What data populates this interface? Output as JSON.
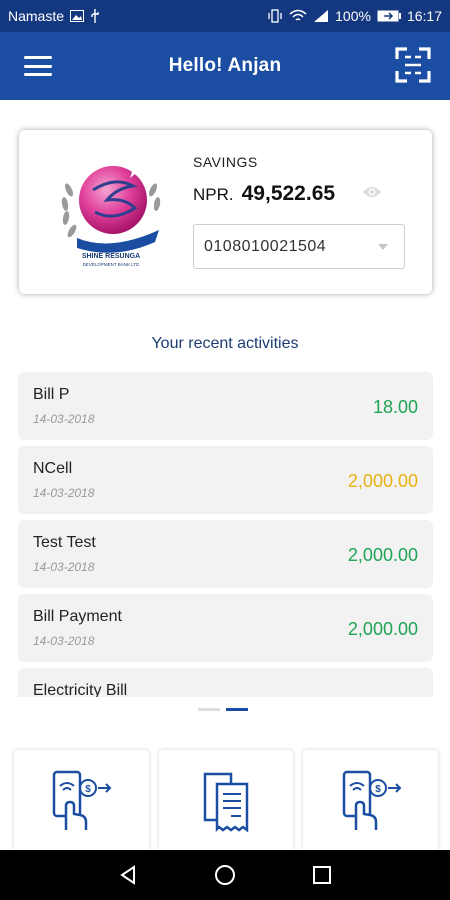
{
  "status_bar": {
    "carrier": "Namaste",
    "battery": "100%",
    "time": "16:17"
  },
  "app_bar": {
    "title": "Hello! Anjan"
  },
  "account": {
    "bank_logo_text": "SHINE RESUNGA",
    "bank_logo_subtext": "DEVELOPMENT BANK LTD",
    "type": "SAVINGS",
    "currency": "NPR.",
    "balance": "49,522.65",
    "account_number": "0108010021504"
  },
  "activities": {
    "title": "Your recent activities",
    "items": [
      {
        "name": "Bill P",
        "date": "14-03-2018",
        "amount": "18.00",
        "status": "green"
      },
      {
        "name": "NCell",
        "date": "14-03-2018",
        "amount": "2,000.00",
        "status": "yellow"
      },
      {
        "name": "Test Test",
        "date": "14-03-2018",
        "amount": "2,000.00",
        "status": "green"
      },
      {
        "name": "Bill Payment",
        "date": "14-03-2018",
        "amount": "2,000.00",
        "status": "green"
      },
      {
        "name": "Electricity Bill",
        "date": "",
        "amount": "",
        "status": "green"
      }
    ]
  },
  "pager": {
    "count": 2,
    "active": 1
  },
  "tiles": [
    {
      "icon": "phone-send-money-icon"
    },
    {
      "icon": "bill-receipt-icon"
    },
    {
      "icon": "phone-transfer-icon"
    }
  ],
  "colors": {
    "primary": "#1b4ea3",
    "status_bar": "#14387f",
    "green": "#1fa456",
    "yellow": "#e7b10f"
  }
}
